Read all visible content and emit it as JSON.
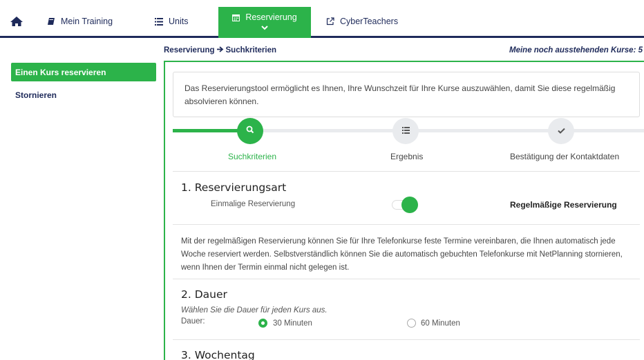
{
  "nav": {
    "training": "Mein Training",
    "units": "Units",
    "reservation": "Reservierung",
    "cyber": "CyberTeachers",
    "active_color": "#2cb34a",
    "brand_color": "#1e2a5a"
  },
  "sidebar": {
    "reserve": "Einen Kurs reservieren",
    "cancel": "Stornieren"
  },
  "breadcrumb": {
    "parent": "Reservierung",
    "current": "Suchkriterien"
  },
  "pending": "Meine noch ausstehenden Kurse: 5",
  "info": "Das Reservierungstool ermöglicht es Ihnen, Ihre Wunschzeit für Ihre Kurse auszuwählen, damit Sie diese regelmäßig absolvieren können.",
  "steps": [
    {
      "label": "Suchkriterien",
      "icon": "search-icon",
      "active": true
    },
    {
      "label": "Ergebnis",
      "icon": "list-icon",
      "active": false
    },
    {
      "label": "Bestätigung der Kontaktdaten",
      "icon": "check-icon",
      "active": false
    }
  ],
  "section1": {
    "title": "1. Reservierungsart",
    "option_left": "Einmalige Reservierung",
    "option_right": "Regelmäßige Reservierung",
    "toggle_on": true,
    "description": "Mit der regelmäßigen Reservierung können Sie für Ihre Telefonkurse feste Termine vereinbaren, die Ihnen automatisch jede Woche reserviert werden. Selbstverständlich können Sie die automatisch gebuchten Telefonkurse mit NetPlanning stornieren, wenn Ihnen der Termin einmal nicht gelegen ist."
  },
  "section2": {
    "title": "2. Dauer",
    "hint": "Wählen Sie die Dauer für jeden Kurs aus.",
    "label": "Dauer:",
    "options": [
      "30 Minuten",
      "60 Minuten"
    ],
    "selected": "30 Minuten"
  },
  "section3": {
    "title": "3. Wochentag"
  }
}
